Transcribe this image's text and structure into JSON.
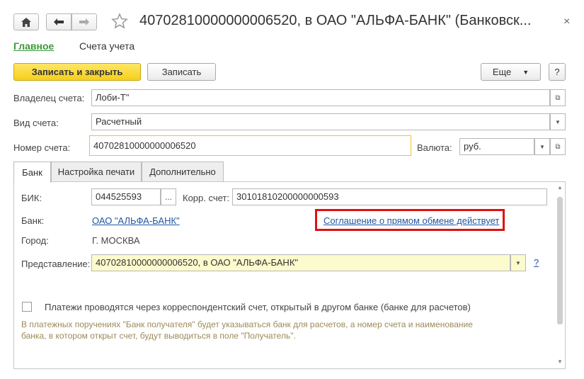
{
  "window": {
    "title": "40702810000000006520, в ОАО \"АЛЬФА-БАНК\" (Банковск...",
    "close": "×"
  },
  "nav": {
    "main": "Главное",
    "accounts": "Счета учета"
  },
  "toolbar": {
    "save_close": "Записать и закрыть",
    "save": "Записать",
    "more": "Еще",
    "help": "?"
  },
  "form": {
    "owner_label": "Владелец счета:",
    "owner_value": "Лоби-Т\"",
    "type_label": "Вид счета:",
    "type_value": "Расчетный",
    "number_label": "Номер счета:",
    "number_value": "40702810000000006520",
    "currency_label": "Валюта:",
    "currency_value": "руб."
  },
  "tabs": [
    "Банк",
    "Настройка печати",
    "Дополнительно"
  ],
  "bank": {
    "bik_label": "БИК:",
    "bik_value": "044525593",
    "bik_more": "...",
    "corr_label": "Корр. счет:",
    "corr_value": "30101810200000000593",
    "bank_label": "Банк:",
    "bank_value": "ОАО \"АЛЬФА-БАНК\"",
    "agreement": "Соглашение о прямом обмене действует",
    "city_label": "Город:",
    "city_value": "Г. МОСКВА",
    "repr_label": "Представление:",
    "repr_value": "40702810000000006520, в ОАО \"АЛЬФА-БАНК\"",
    "repr_help": "?",
    "checkbox_label": "Платежи проводятся через корреспондентский счет, открытый в другом банке (банке для расчетов)",
    "note_line1": "В платежных поручениях \"Банк получателя\" будет указываться банк для расчетов, а номер счета и наименование",
    "note_line2": "банка, в котором открыт счет, будут выводиться в поле \"Получатель\"."
  },
  "colors": {
    "accent_green": "#3a9a3a",
    "primary_yellow": "#f5cf1c",
    "highlight_red": "#e01010",
    "link_blue": "#2255a4"
  }
}
